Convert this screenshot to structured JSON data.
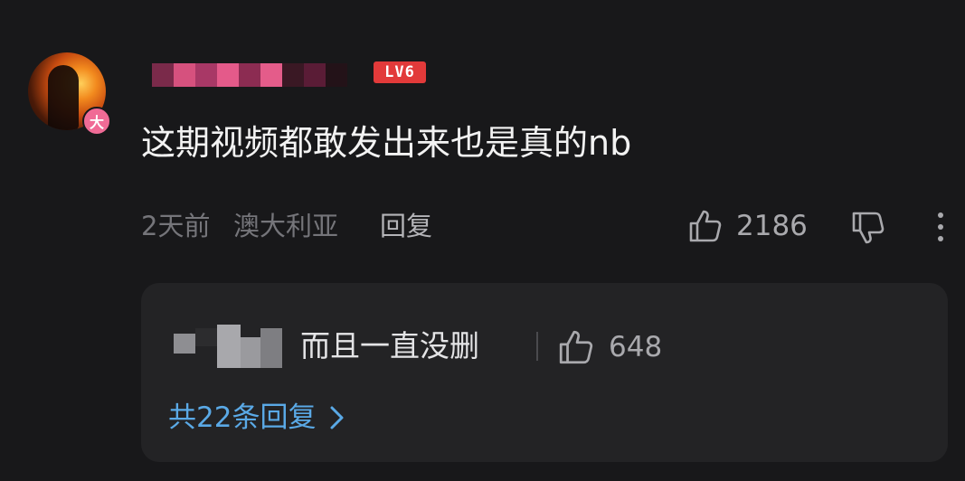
{
  "comment": {
    "vip_badge": "大",
    "level": "LV6",
    "text": "这期视频都敢发出来也是真的nb",
    "time": "2天前",
    "location": "澳大利亚",
    "reply_label": "回复",
    "like_count": "2186"
  },
  "reply_preview": {
    "text": "而且一直没删",
    "like_count": "648",
    "view_replies_label": "共22条回复"
  },
  "colors": {
    "background": "#18181a",
    "reply_box": "#232325",
    "level_badge": "#e23a3a",
    "vip_badge": "#f06b96",
    "link_blue": "#5aa9e6"
  },
  "icons": [
    "thumbs-up-icon",
    "thumbs-down-icon",
    "more-vertical-icon",
    "chevron-right-icon"
  ]
}
